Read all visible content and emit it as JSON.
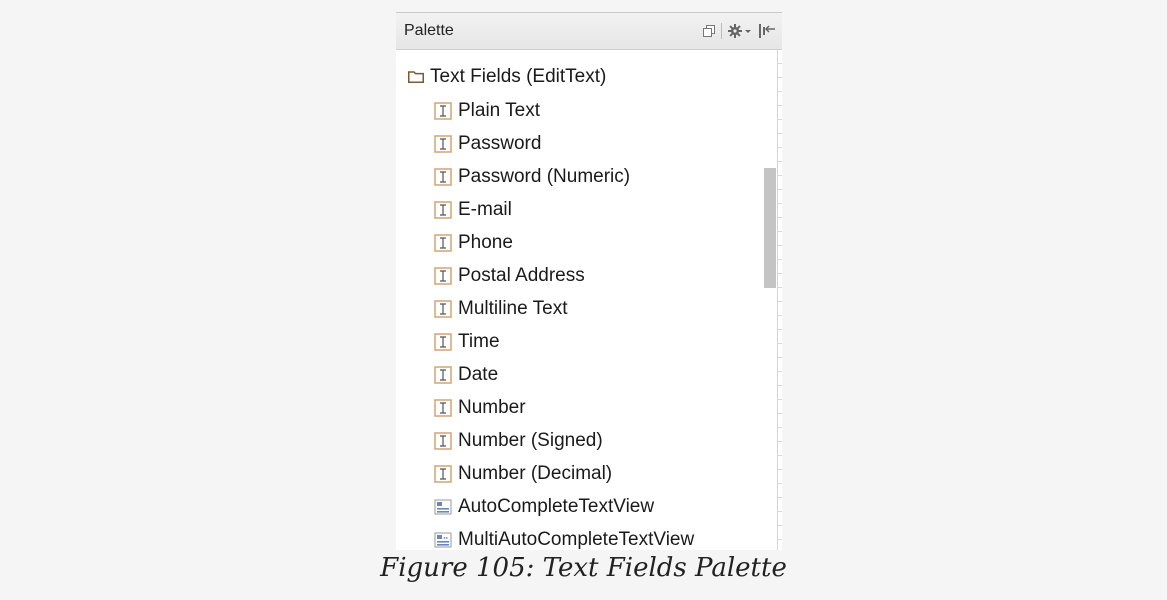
{
  "palette": {
    "title": "Palette",
    "tools": [
      {
        "icon": "restore-icon"
      },
      {
        "icon": "gear-dropdown-icon"
      },
      {
        "icon": "pin-icon"
      }
    ],
    "group": {
      "label": "Text Fields (EditText)",
      "icon": "folder-icon"
    },
    "items": [
      {
        "label": "Plain Text",
        "icon": "text-field-icon"
      },
      {
        "label": "Password",
        "icon": "text-field-icon"
      },
      {
        "label": "Password (Numeric)",
        "icon": "text-field-icon"
      },
      {
        "label": "E-mail",
        "icon": "text-field-icon"
      },
      {
        "label": "Phone",
        "icon": "text-field-icon"
      },
      {
        "label": "Postal Address",
        "icon": "text-field-icon"
      },
      {
        "label": "Multiline Text",
        "icon": "text-field-icon"
      },
      {
        "label": "Time",
        "icon": "text-field-icon"
      },
      {
        "label": "Date",
        "icon": "text-field-icon"
      },
      {
        "label": "Number",
        "icon": "text-field-icon"
      },
      {
        "label": "Number (Signed)",
        "icon": "text-field-icon"
      },
      {
        "label": "Number (Decimal)",
        "icon": "text-field-icon"
      },
      {
        "label": "AutoCompleteTextView",
        "icon": "autocomplete-icon"
      },
      {
        "label": "MultiAutoCompleteTextView",
        "icon": "multi-autocomplete-icon"
      }
    ]
  },
  "caption": "Figure 105: Text Fields Palette",
  "colors": {
    "icon_border": "#d4a373",
    "folder": "#7a5a2e"
  }
}
